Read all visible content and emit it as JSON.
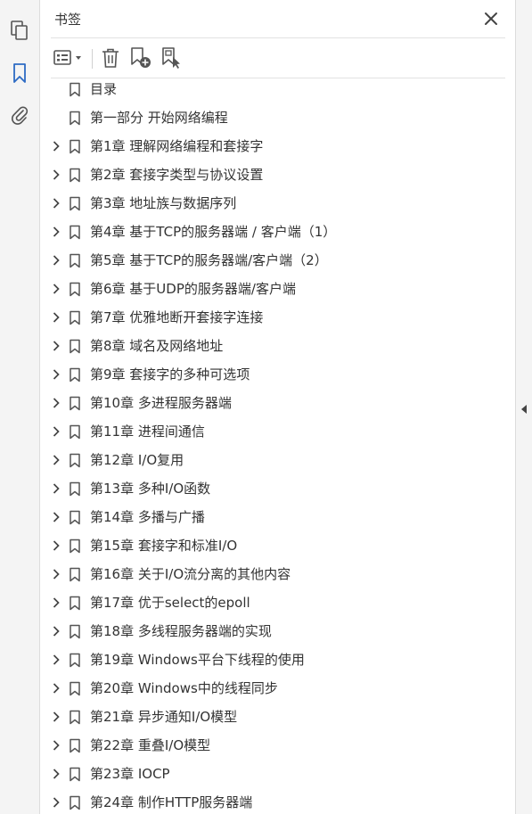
{
  "panel": {
    "title": "书签"
  },
  "icons": {
    "pages": "pages-icon",
    "bookmarks": "bookmark-icon",
    "attachments": "paperclip-icon",
    "close": "close-icon",
    "options": "options-menu-icon",
    "delete": "trash-icon",
    "new_bookmark": "new-bookmark-icon",
    "new_from_structure": "new-bookmark-from-structure-icon"
  },
  "colors": {
    "accent": "#2d6bc4",
    "icon": "#555555",
    "text": "#333333"
  },
  "bookmarks": [
    {
      "label": "目录",
      "expandable": false
    },
    {
      "label": "第一部分 开始网络编程",
      "expandable": false
    },
    {
      "label": "第1章 理解网络编程和套接字",
      "expandable": true
    },
    {
      "label": "第2章 套接字类型与协议设置",
      "expandable": true
    },
    {
      "label": "第3章 地址族与数据序列",
      "expandable": true
    },
    {
      "label": "第4章 基于TCP的服务器端 / 客户端（1）",
      "expandable": true
    },
    {
      "label": "第5章 基于TCP的服务器端/客户端（2）",
      "expandable": true
    },
    {
      "label": "第6章 基于UDP的服务器端/客户端",
      "expandable": true
    },
    {
      "label": "第7章 优雅地断开套接字连接",
      "expandable": true
    },
    {
      "label": "第8章 域名及网络地址",
      "expandable": true
    },
    {
      "label": "第9章 套接字的多种可选项",
      "expandable": true
    },
    {
      "label": "第10章 多进程服务器端",
      "expandable": true
    },
    {
      "label": "第11章 进程间通信",
      "expandable": true
    },
    {
      "label": "第12章 I/O复用",
      "expandable": true
    },
    {
      "label": "第13章 多种I/O函数",
      "expandable": true
    },
    {
      "label": "第14章 多播与广播",
      "expandable": true
    },
    {
      "label": "第15章 套接字和标准I/O",
      "expandable": true
    },
    {
      "label": "第16章 关于I/O流分离的其他内容",
      "expandable": true
    },
    {
      "label": "第17章 优于select的epoll",
      "expandable": true
    },
    {
      "label": "第18章 多线程服务器端的实现",
      "expandable": true
    },
    {
      "label": "第19章 Windows平台下线程的使用",
      "expandable": true
    },
    {
      "label": "第20章 Windows中的线程同步",
      "expandable": true
    },
    {
      "label": "第21章 异步通知I/O模型",
      "expandable": true
    },
    {
      "label": "第22章 重叠I/O模型",
      "expandable": true
    },
    {
      "label": "第23章 IOCP",
      "expandable": true
    },
    {
      "label": "第24章 制作HTTP服务器端",
      "expandable": true
    }
  ]
}
